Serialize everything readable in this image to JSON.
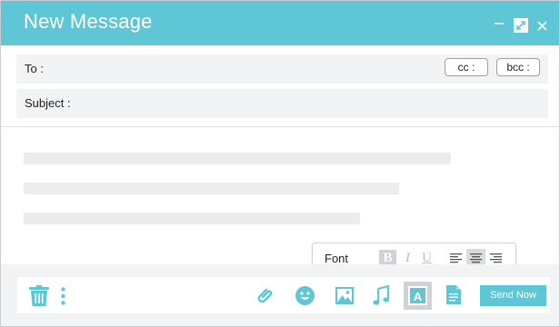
{
  "window": {
    "title": "New Message",
    "controls": [
      "minimize-icon",
      "expand-icon",
      "close-icon"
    ]
  },
  "fields": {
    "to_label": "To :",
    "cc_label": "cc :",
    "bcc_label": "bcc :",
    "subject_label": "Subject :"
  },
  "format_bar": {
    "font_label": "Font",
    "bold_label": "B",
    "italic_label": "I",
    "underline_label": "U",
    "align_active": "center"
  },
  "toolbar": {
    "icons": [
      "trash-icon",
      "more-vertical-icon",
      "attachment-icon",
      "emoji-icon",
      "image-icon",
      "music-icon",
      "text-format-icon",
      "document-icon"
    ],
    "send_label": "Send Now"
  },
  "colors": {
    "accent": "#5fc6d5",
    "field_bg": "#f2f3f5",
    "skeleton": "#ebecee"
  }
}
